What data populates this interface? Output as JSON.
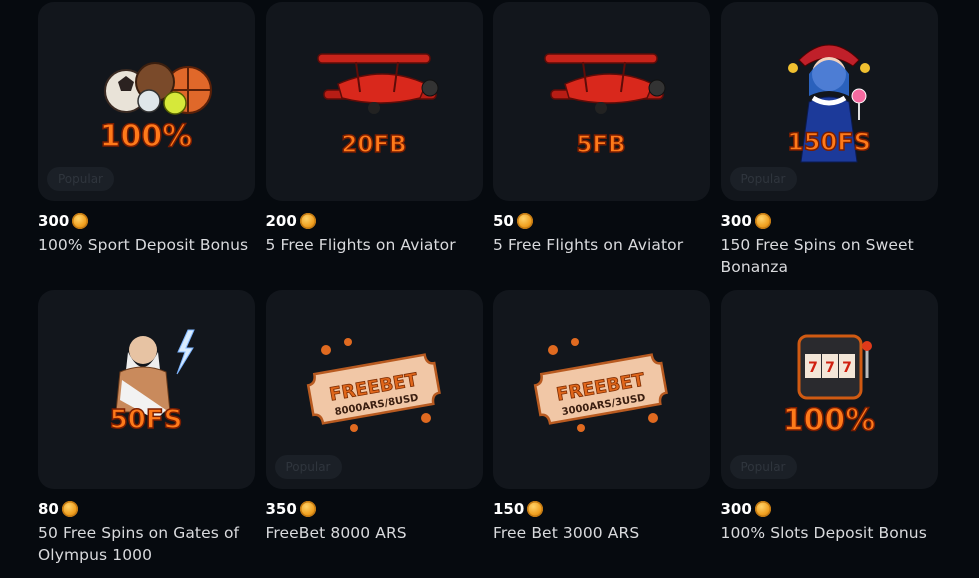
{
  "cards": [
    {
      "price": "300",
      "title": "100% Sport Deposit Bonus",
      "badge": "Popular",
      "art_text": "100%",
      "art": "sport-balls"
    },
    {
      "price": "200",
      "title": "5 Free Flights on Aviator",
      "badge": "",
      "art_text": "20FB",
      "art": "biplane"
    },
    {
      "price": "50",
      "title": "5 Free Flights on Aviator",
      "badge": "",
      "art_text": "5FB",
      "art": "biplane"
    },
    {
      "price": "300",
      "title": "150 Free Spins on Sweet Bonanza",
      "badge": "Popular",
      "art_text": "150FS",
      "art": "jester-girl"
    },
    {
      "price": "80",
      "title": "50 Free Spins on Gates of Olympus 1000",
      "badge": "",
      "art_text": "50FS",
      "art": "zeus"
    },
    {
      "price": "350",
      "title": "FreeBet 8000 ARS",
      "badge": "Popular",
      "art_text": "FREEBET",
      "art_sub": "8000ARS/8USD",
      "art": "ticket"
    },
    {
      "price": "150",
      "title": "Free Bet 3000 ARS",
      "badge": "",
      "art_text": "FREEBET",
      "art_sub": "3000ARS/3USD",
      "art": "ticket"
    },
    {
      "price": "300",
      "title": "100% Slots Deposit Bonus",
      "badge": "Popular",
      "art_text": "100%",
      "art": "slot-machine"
    }
  ],
  "colors": {
    "background": "#060a0f",
    "card": "#12161c",
    "accent": "#ff7a1a",
    "coin": "#f0a020"
  },
  "icons": {
    "currency": "coin-icon"
  }
}
